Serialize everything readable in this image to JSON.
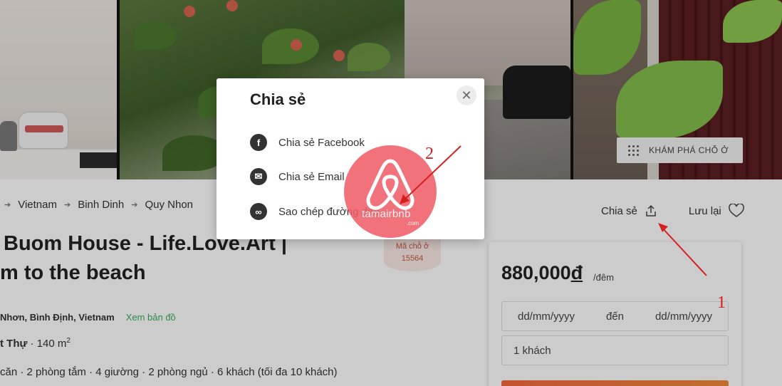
{
  "photos": {
    "explore_label": "KHÁM PHÁ CHỖ Ở"
  },
  "breadcrumb": [
    "Vietnam",
    "Binh Dinh",
    "Quy Nhon"
  ],
  "listing": {
    "title_line1": "Buom House - Life.Love.Art |",
    "title_line2": "m to the beach",
    "code_label": "Mã chỗ ở",
    "code_value": "15564",
    "address": "Nhơn, Bình Định, Vietnam",
    "map_link": "Xem bản đồ",
    "type": "t Thự",
    "area": "· 140 m",
    "area_unit_sup": "2",
    "amenities": "căn · 2 phòng tắm · 4 giường · 2 phòng ngủ · 6 khách (tối đa 10 khách)"
  },
  "actions": {
    "share": "Chia sẻ",
    "save": "Lưu lại"
  },
  "booking": {
    "price": "880,000",
    "currency": "đ",
    "per": "/đêm",
    "date_from": "dd/mm/yyyy",
    "date_sep": "đến",
    "date_to": "dd/mm/yyyy",
    "guests": "1 khách"
  },
  "share_modal": {
    "title": "Chia sẻ",
    "close_glyph": "✕",
    "options": [
      {
        "label": "Chia sẻ Facebook",
        "icon": "facebook-icon"
      },
      {
        "label": "Chia sẻ Email",
        "icon": "email-icon"
      },
      {
        "label": "Sao chép đường dẫn",
        "icon": "link-icon"
      }
    ]
  },
  "watermark": {
    "text": "tamairbnb",
    "sub": ".com"
  },
  "annotations": {
    "step1": "1",
    "step2": "2"
  },
  "colors": {
    "accent": "#f3683d",
    "map_link": "#3dae5c",
    "annotation": "#d62020",
    "watermark": "#f05f69"
  }
}
